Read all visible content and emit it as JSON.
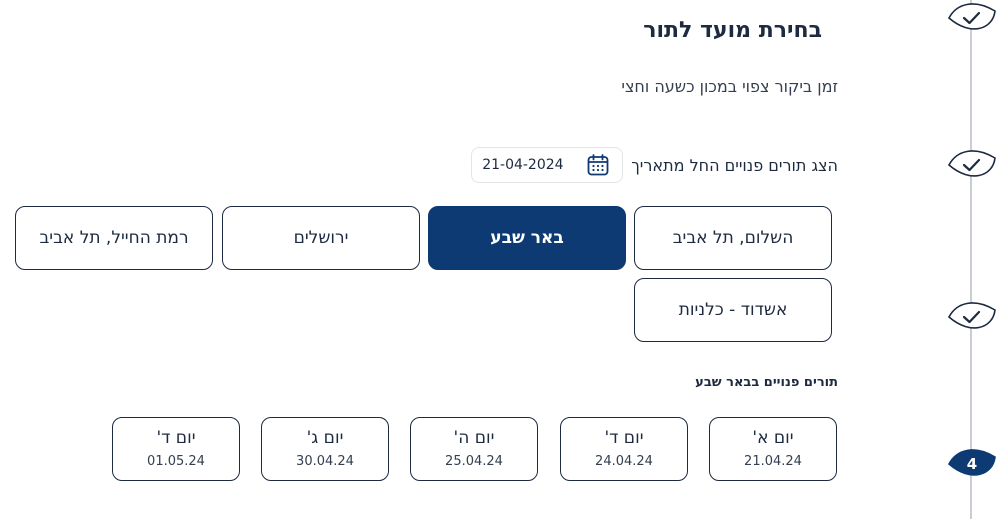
{
  "page": {
    "title": "בחירת מועד לתור",
    "subtitle": "זמן ביקור צפוי במכון כשעה וחצי"
  },
  "date_filter": {
    "label": "הצג תורים פנויים החל מתאריך",
    "value": "21-04-2024",
    "icon": "calendar-icon"
  },
  "branches": [
    {
      "label": "השלום, תל אביב",
      "selected": false
    },
    {
      "label": "באר שבע",
      "selected": true
    },
    {
      "label": "ירושלים",
      "selected": false
    },
    {
      "label": "רמת החייל, תל אביב",
      "selected": false
    },
    {
      "label": "אשדוד - כלניות",
      "selected": false
    }
  ],
  "available": {
    "title": "תורים פנויים בבאר שבע",
    "days": [
      {
        "day": "יום א'",
        "date": "21.04.24"
      },
      {
        "day": "יום ד'",
        "date": "24.04.24"
      },
      {
        "day": "יום ה'",
        "date": "25.04.24"
      },
      {
        "day": "יום ג'",
        "date": "30.04.24"
      },
      {
        "day": "יום ד'",
        "date": "01.05.24"
      }
    ]
  },
  "stepper": {
    "steps": [
      {
        "state": "done",
        "icon": "check-icon"
      },
      {
        "state": "done",
        "icon": "check-icon"
      },
      {
        "state": "done",
        "icon": "check-icon"
      },
      {
        "state": "current",
        "number": "4"
      }
    ],
    "colors": {
      "done_fill": "#ffffff",
      "current_fill": "#0e3a74",
      "outline": "#1d2a3f"
    }
  },
  "colors": {
    "primary": "#0e3a74",
    "text": "#1d2a3f",
    "border": "#1d2a3f"
  }
}
